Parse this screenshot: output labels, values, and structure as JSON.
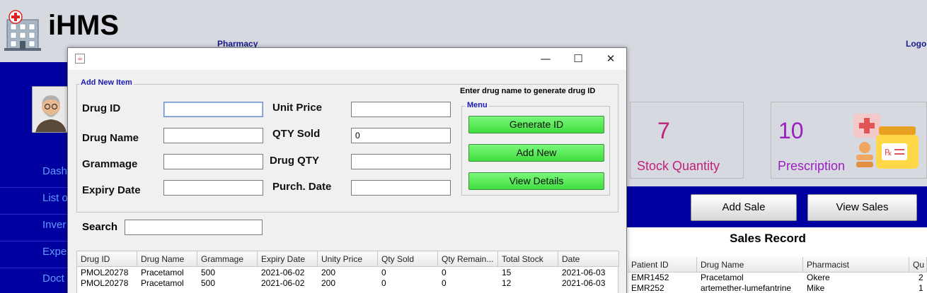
{
  "app": {
    "brand": "iHMS",
    "page_title": "Pharmacy",
    "logout": "Logo"
  },
  "sidebar": {
    "items": [
      {
        "label": "Dash"
      },
      {
        "label": "List o"
      },
      {
        "label": "Inver"
      },
      {
        "label": "Expe"
      },
      {
        "label": "Doct"
      }
    ]
  },
  "stats": [
    {
      "value": "7",
      "label": "Stock Quantity",
      "color": "#c0207a"
    },
    {
      "value": "10",
      "label": "Prescription",
      "color": "#9b20c0"
    }
  ],
  "sales": {
    "add_sale": "Add Sale",
    "view_sales": "View Sales",
    "title": "Sales Record",
    "columns": [
      "Patient ID",
      "Drug Name",
      "Pharmacist",
      "Qu"
    ],
    "rows": [
      [
        "EMR1452",
        "Pracetamol",
        "Okere",
        "2"
      ],
      [
        "EMR252",
        "artemether-lumefantrine",
        "Mike",
        "1"
      ]
    ]
  },
  "dialog": {
    "group_title": "Add New Item",
    "hint": "Enter drug name to generate drug ID",
    "menu_title": "Menu",
    "fields": {
      "drug_id": {
        "label": "Drug ID",
        "value": ""
      },
      "drug_name": {
        "label": "Drug Name",
        "value": ""
      },
      "grammage": {
        "label": "Grammage",
        "value": ""
      },
      "expiry_date": {
        "label": "Expiry Date",
        "value": ""
      },
      "unit_price": {
        "label": "Unit Price",
        "value": ""
      },
      "qty_sold": {
        "label": "QTY Sold",
        "value": "0"
      },
      "drug_qty": {
        "label": "Drug QTY",
        "value": ""
      },
      "purch_date": {
        "label": "Purch. Date",
        "value": ""
      }
    },
    "buttons": {
      "generate": "Generate ID",
      "add_new": "Add New",
      "view_details": "View Details"
    },
    "search_label": "Search",
    "window_controls": {
      "minimize": "—",
      "maximize": "☐",
      "close": "✕"
    },
    "table": {
      "columns": [
        "Drug ID",
        "Drug Name",
        "Grammage",
        "Expiry Date",
        "Unity Price",
        "Qty Sold",
        "Qty Remain...",
        "Total Stock",
        "Date"
      ],
      "rows": [
        [
          "PMOL20278",
          "Pracetamol",
          "500",
          "2021-06-02",
          "200",
          "0",
          "0",
          "15",
          "2021-06-03"
        ],
        [
          "PMOL20278",
          "Pracetamol",
          "500",
          "2021-06-02",
          "200",
          "0",
          "0",
          "12",
          "2021-06-03"
        ]
      ]
    }
  }
}
